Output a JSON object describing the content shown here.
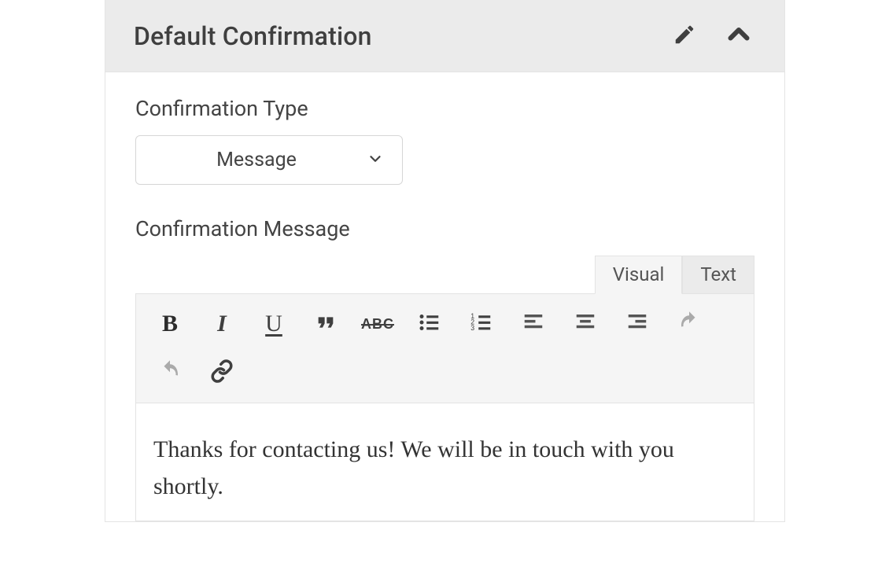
{
  "panel": {
    "title": "Default Confirmation"
  },
  "fields": {
    "type_label": "Confirmation Type",
    "type_value": "Message",
    "message_label": "Confirmation Message"
  },
  "editor": {
    "tabs": {
      "visual": "Visual",
      "text": "Text",
      "active": "visual"
    },
    "toolbar": {
      "bold": "B",
      "italic": "I",
      "underline": "U",
      "strikethrough": "ABC"
    },
    "content": "Thanks for contacting us! We will be in touch with you shortly."
  }
}
